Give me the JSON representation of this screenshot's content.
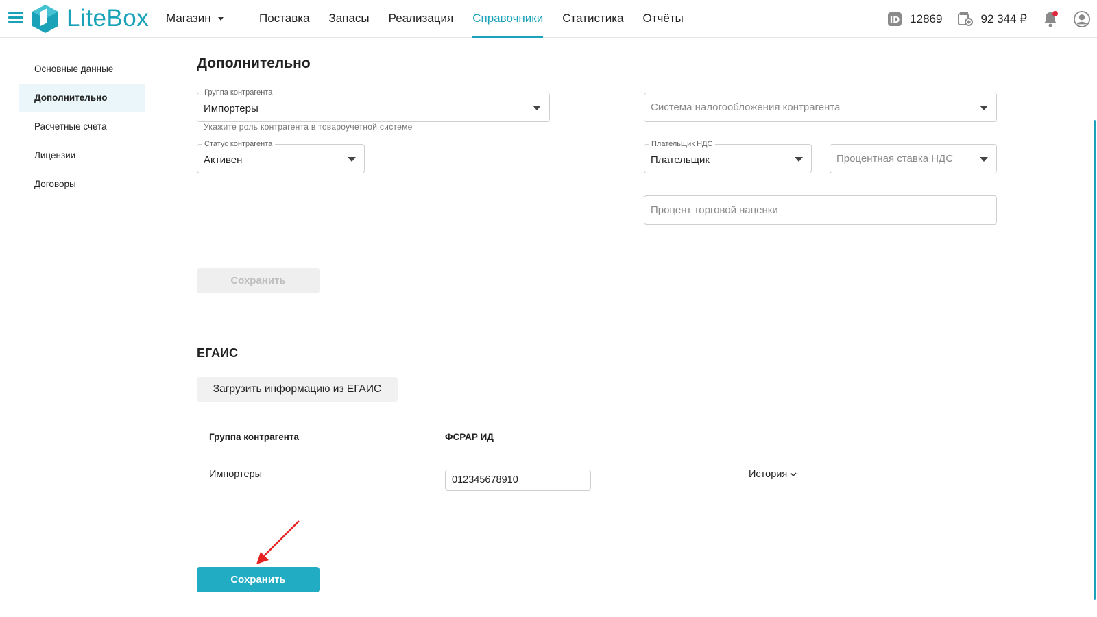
{
  "header": {
    "logo_text": "LiteBox",
    "store": "Магазин",
    "nav": [
      "Поставка",
      "Запасы",
      "Реализация",
      "Справочники",
      "Статистика",
      "Отчёты"
    ],
    "active_nav": "Справочники",
    "id_value": "12869",
    "balance": "92 344 ₽"
  },
  "sidebar": {
    "items": [
      "Основные данные",
      "Дополнительно",
      "Расчетные счета",
      "Лицензии",
      "Договоры"
    ],
    "active": "Дополнительно"
  },
  "additional": {
    "title": "Дополнительно",
    "group": {
      "label": "Группа контрагента",
      "value": "Импортеры",
      "hint": "Укажите роль контрагента в товароучетной системе"
    },
    "status": {
      "label": "Статус контрагента",
      "value": "Активен"
    },
    "tax_system": {
      "placeholder": "Система налогообложения контрагента"
    },
    "vat_payer": {
      "label": "Плательщик НДС",
      "value": "Плательщик"
    },
    "vat_rate": {
      "placeholder": "Процентная ставка НДС"
    },
    "markup": {
      "placeholder": "Процент торговой наценки"
    },
    "save_label": "Сохранить"
  },
  "egais": {
    "title": "ЕГАИС",
    "load_label": "Загрузить информацию из ЕГАИС",
    "columns": [
      "Группа контрагента",
      "ФСРАР ИД"
    ],
    "row": {
      "group": "Импортеры",
      "fsrar_id": "012345678910",
      "history_label": "История"
    },
    "save_label": "Сохранить"
  },
  "colors": {
    "accent": "#1aa3b8",
    "button": "#22acc3",
    "annotation": "#e52323"
  }
}
